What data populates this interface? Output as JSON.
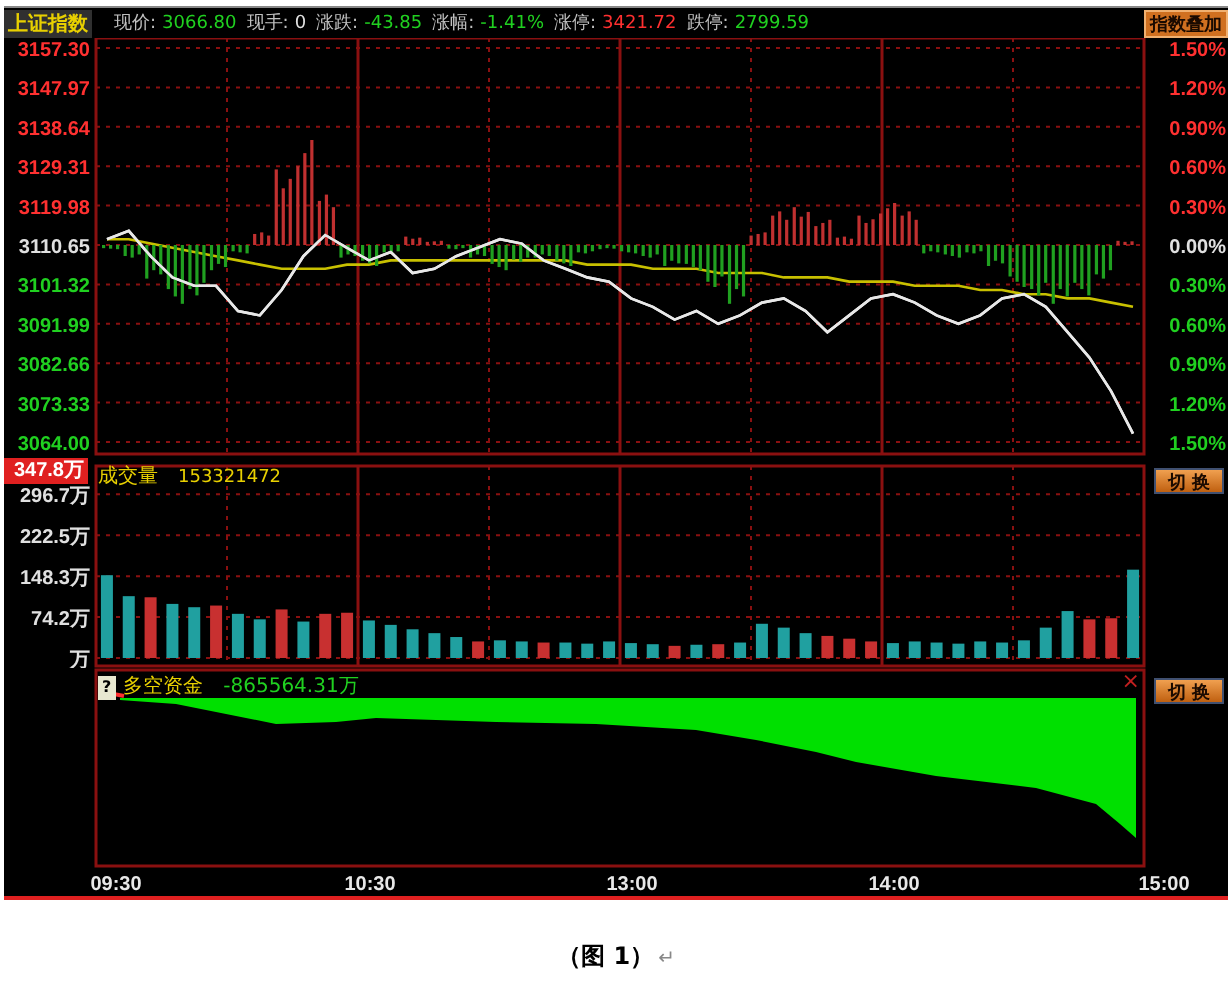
{
  "header": {
    "title": "上证指数",
    "quotes": [
      {
        "label": "现价:",
        "value": "3066.80",
        "color": "#20d020"
      },
      {
        "label": "现手:",
        "value": "0",
        "color": "#e0e0e0"
      },
      {
        "label": "涨跌:",
        "value": "-43.85",
        "color": "#20d020"
      },
      {
        "label": "涨幅:",
        "value": "-1.41%",
        "color": "#20d020"
      },
      {
        "label": "涨停:",
        "value": "3421.72",
        "color": "#ff3030"
      },
      {
        "label": "跌停:",
        "value": "2799.59",
        "color": "#20d020"
      }
    ],
    "overlay_button": "指数叠加"
  },
  "price_panel": {
    "chart_data": {
      "type": "line",
      "grid": true,
      "ylim": [
        3064.0,
        3157.3
      ],
      "yticks": [
        {
          "value": 3157.3,
          "label": "3157.30"
        },
        {
          "value": 3147.97,
          "label": "3147.97"
        },
        {
          "value": 3138.64,
          "label": "3138.64"
        },
        {
          "value": 3129.31,
          "label": "3129.31"
        },
        {
          "value": 3119.98,
          "label": "3119.98"
        },
        {
          "value": 3110.65,
          "label": "3110.65"
        },
        {
          "value": 3101.32,
          "label": "3101.32"
        },
        {
          "value": 3091.99,
          "label": "3091.99"
        },
        {
          "value": 3082.66,
          "label": "3082.66"
        },
        {
          "value": 3073.33,
          "label": "3073.33"
        },
        {
          "value": 3064.0,
          "label": "3064.00"
        }
      ],
      "series": [
        {
          "color": "#e8e8e8",
          "values": [
            3112,
            3114,
            3108,
            3103,
            3101,
            3101,
            3095,
            3094,
            3100,
            3108,
            3113,
            3110,
            3107,
            3109,
            3104,
            3105,
            3108,
            3110,
            3112,
            3111,
            3107,
            3105,
            3103,
            3102,
            3098,
            3096,
            3093,
            3095,
            3092,
            3094,
            3097,
            3098,
            3095,
            3090,
            3094,
            3098,
            3099,
            3097,
            3094,
            3092,
            3094,
            3098,
            3099,
            3096,
            3090,
            3084,
            3076,
            3066
          ]
        },
        {
          "color": "#c8c000",
          "values": [
            3112,
            3112,
            3111,
            3110,
            3109,
            3108,
            3107,
            3106,
            3105,
            3105,
            3105,
            3106,
            3106,
            3107,
            3107,
            3107,
            3107,
            3107,
            3107,
            3107,
            3107,
            3107,
            3106,
            3106,
            3106,
            3105,
            3105,
            3105,
            3104,
            3104,
            3104,
            3103,
            3103,
            3103,
            3102,
            3102,
            3102,
            3101,
            3101,
            3101,
            3100,
            3100,
            3099,
            3099,
            3098,
            3098,
            3097,
            3096
          ]
        }
      ]
    },
    "right_ticks": [
      {
        "label": "1.50%",
        "color": "#ff3030"
      },
      {
        "label": "1.20%",
        "color": "#ff3030"
      },
      {
        "label": "0.90%",
        "color": "#ff3030"
      },
      {
        "label": "0.60%",
        "color": "#ff3030"
      },
      {
        "label": "0.30%",
        "color": "#ff3030"
      },
      {
        "label": "0.00%",
        "color": "#e0e0e0"
      },
      {
        "label": "0.30%",
        "color": "#20d020"
      },
      {
        "label": "0.60%",
        "color": "#20d020"
      },
      {
        "label": "0.90%",
        "color": "#20d020"
      },
      {
        "label": "1.20%",
        "color": "#20d020"
      },
      {
        "label": "1.50%",
        "color": "#20d020"
      }
    ]
  },
  "volume_panel": {
    "title": "成交量",
    "total": "153321472",
    "max_label": "347.8万",
    "switch_button": "切 换",
    "chart_data": {
      "type": "bar",
      "stacked": true,
      "grid": true,
      "ylim": [
        0,
        347.8
      ],
      "yticks": [
        {
          "value": 296.7,
          "label": "296.7万"
        },
        {
          "value": 222.5,
          "label": "222.5万"
        },
        {
          "value": 148.3,
          "label": "148.3万"
        },
        {
          "value": 74.2,
          "label": "74.2万"
        },
        {
          "value": 0,
          "label": "万"
        }
      ],
      "series": [
        {
          "color": "#c83030",
          "values": [
            null,
            null,
            110,
            null,
            null,
            95,
            null,
            null,
            88,
            null,
            80,
            82,
            null,
            null,
            null,
            null,
            null,
            30,
            null,
            null,
            28,
            null,
            null,
            null,
            null,
            null,
            22,
            null,
            25,
            null,
            null,
            null,
            null,
            40,
            35,
            30,
            null,
            null,
            null,
            null,
            null,
            null,
            null,
            null,
            null,
            70,
            72,
            null
          ]
        },
        {
          "color": "#20a0a0",
          "values": [
            150,
            112,
            null,
            98,
            92,
            null,
            80,
            70,
            null,
            66,
            null,
            null,
            68,
            60,
            52,
            45,
            38,
            null,
            32,
            30,
            null,
            28,
            26,
            30,
            27,
            25,
            null,
            24,
            null,
            28,
            62,
            55,
            45,
            null,
            null,
            null,
            27,
            30,
            28,
            26,
            30,
            28,
            32,
            55,
            85,
            null,
            null,
            160
          ]
        }
      ]
    }
  },
  "fund_panel": {
    "help_glyph": "?",
    "title": "多空资金",
    "value": "-865564.31万",
    "close_glyph": "×",
    "switch_button": "切 换"
  },
  "time_axis": {
    "labels": [
      "09:30",
      "10:30",
      "13:00",
      "14:00",
      "15:00"
    ]
  },
  "caption": {
    "text": "（图 1）",
    "mark": "↵"
  }
}
